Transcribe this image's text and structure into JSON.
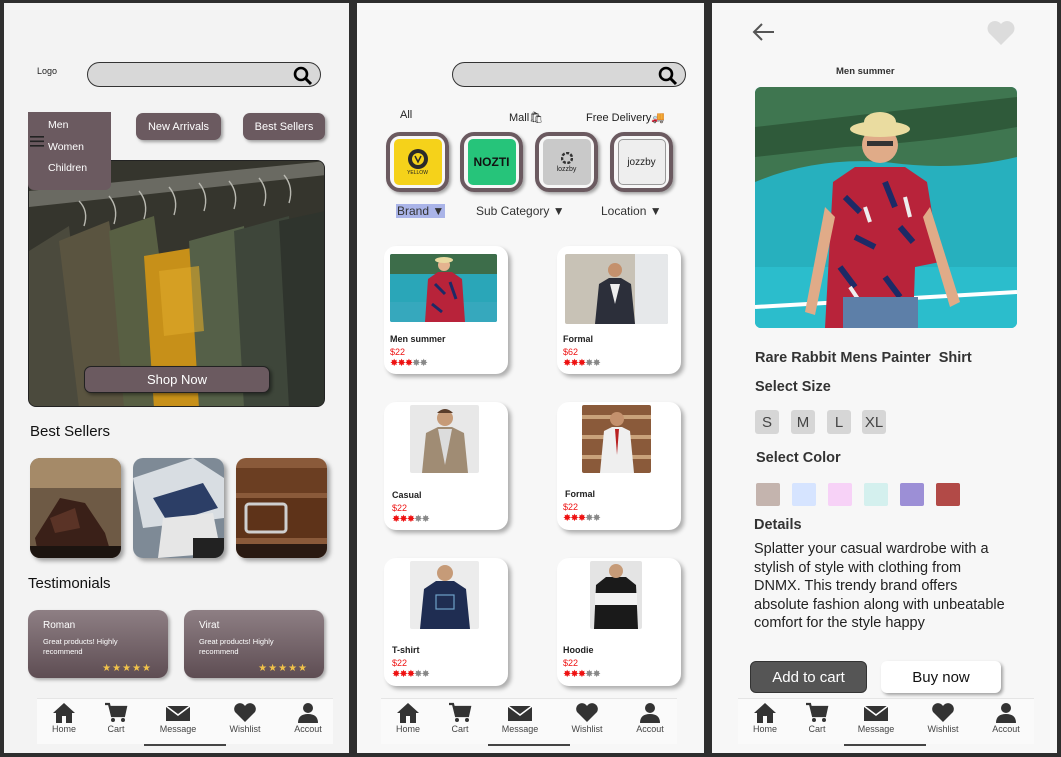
{
  "screen1": {
    "logo": "Logo",
    "menu_items": [
      "Men",
      "Women",
      "Children"
    ],
    "new_arrivals": "New Arrivals",
    "best_sellers_btn": "Best Sellers",
    "shop_now": "Shop Now",
    "best_sellers_title": "Best Sellers",
    "testimonials_title": "Testimonials",
    "testimonials": [
      {
        "name": "Roman",
        "text": "Great products! Highly recommend",
        "stars": "★★★★★"
      },
      {
        "name": "Virat",
        "text": "Great products! Highly recommend",
        "stars": "★★★★★"
      }
    ]
  },
  "screen2": {
    "tabs": {
      "all": "All",
      "mall": "Mall🛍",
      "free_delivery": "Free Delivery🚚"
    },
    "brands": [
      "YELLOW",
      "NOZTI",
      "lozzby",
      "jozzby"
    ],
    "filters": {
      "brand": "Brand ▼",
      "sub_category": "Sub Category ▼",
      "location": "Location ▼"
    },
    "products": [
      {
        "name": "Men summer",
        "price": "$22"
      },
      {
        "name": "Formal",
        "price": "$62"
      },
      {
        "name": "Casual",
        "price": "$22"
      },
      {
        "name": "Formal",
        "price": "$22"
      },
      {
        "name": "T-shirt",
        "price": "$22"
      },
      {
        "name": "Hoodie",
        "price": "$22"
      }
    ]
  },
  "screen3": {
    "caption": "Men summer",
    "title": "Rare Rabbit Mens Painter  Shirt",
    "select_size": "Select Size",
    "sizes": [
      "S",
      "M",
      "L",
      "XL"
    ],
    "select_color": "Select Color",
    "colors": [
      "#c4b4ae",
      "#d6e4ff",
      "#f7d2f7",
      "#d4f0ee",
      "#9c8fd6",
      "#b24a47"
    ],
    "details_title": "Details",
    "details": "Splatter your casual wardrobe with a stylish of style with clothing from DNMX. This trendy brand offers absolute fashion along with unbeatable comfort for the style happy",
    "add_to_cart": "Add to cart",
    "buy_now": "Buy now"
  },
  "nav": {
    "home": "Home",
    "cart": "Cart",
    "message": "Message",
    "wishlist": "Wishlist",
    "account": "Accout"
  },
  "colors": {
    "accent": "#6b5a60",
    "price": "#ee1111",
    "star": "#f0c24a"
  }
}
